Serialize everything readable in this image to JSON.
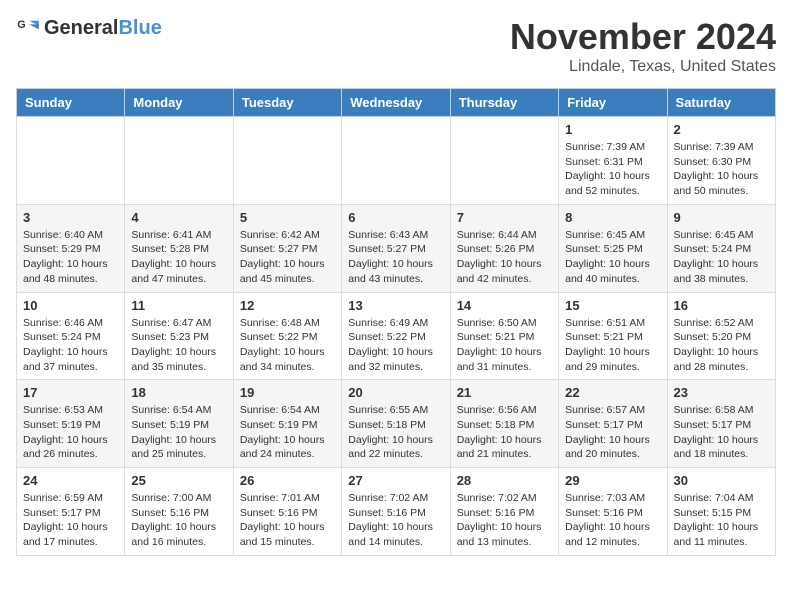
{
  "logo": {
    "general": "General",
    "blue": "Blue"
  },
  "title": "November 2024",
  "subtitle": "Lindale, Texas, United States",
  "days_of_week": [
    "Sunday",
    "Monday",
    "Tuesday",
    "Wednesday",
    "Thursday",
    "Friday",
    "Saturday"
  ],
  "weeks": [
    [
      null,
      null,
      null,
      null,
      null,
      {
        "day": "1",
        "sunrise": "Sunrise: 7:39 AM",
        "sunset": "Sunset: 6:31 PM",
        "daylight": "Daylight: 10 hours and 52 minutes."
      },
      {
        "day": "2",
        "sunrise": "Sunrise: 7:39 AM",
        "sunset": "Sunset: 6:30 PM",
        "daylight": "Daylight: 10 hours and 50 minutes."
      }
    ],
    [
      {
        "day": "3",
        "sunrise": "Sunrise: 6:40 AM",
        "sunset": "Sunset: 5:29 PM",
        "daylight": "Daylight: 10 hours and 48 minutes."
      },
      {
        "day": "4",
        "sunrise": "Sunrise: 6:41 AM",
        "sunset": "Sunset: 5:28 PM",
        "daylight": "Daylight: 10 hours and 47 minutes."
      },
      {
        "day": "5",
        "sunrise": "Sunrise: 6:42 AM",
        "sunset": "Sunset: 5:27 PM",
        "daylight": "Daylight: 10 hours and 45 minutes."
      },
      {
        "day": "6",
        "sunrise": "Sunrise: 6:43 AM",
        "sunset": "Sunset: 5:27 PM",
        "daylight": "Daylight: 10 hours and 43 minutes."
      },
      {
        "day": "7",
        "sunrise": "Sunrise: 6:44 AM",
        "sunset": "Sunset: 5:26 PM",
        "daylight": "Daylight: 10 hours and 42 minutes."
      },
      {
        "day": "8",
        "sunrise": "Sunrise: 6:45 AM",
        "sunset": "Sunset: 5:25 PM",
        "daylight": "Daylight: 10 hours and 40 minutes."
      },
      {
        "day": "9",
        "sunrise": "Sunrise: 6:45 AM",
        "sunset": "Sunset: 5:24 PM",
        "daylight": "Daylight: 10 hours and 38 minutes."
      }
    ],
    [
      {
        "day": "10",
        "sunrise": "Sunrise: 6:46 AM",
        "sunset": "Sunset: 5:24 PM",
        "daylight": "Daylight: 10 hours and 37 minutes."
      },
      {
        "day": "11",
        "sunrise": "Sunrise: 6:47 AM",
        "sunset": "Sunset: 5:23 PM",
        "daylight": "Daylight: 10 hours and 35 minutes."
      },
      {
        "day": "12",
        "sunrise": "Sunrise: 6:48 AM",
        "sunset": "Sunset: 5:22 PM",
        "daylight": "Daylight: 10 hours and 34 minutes."
      },
      {
        "day": "13",
        "sunrise": "Sunrise: 6:49 AM",
        "sunset": "Sunset: 5:22 PM",
        "daylight": "Daylight: 10 hours and 32 minutes."
      },
      {
        "day": "14",
        "sunrise": "Sunrise: 6:50 AM",
        "sunset": "Sunset: 5:21 PM",
        "daylight": "Daylight: 10 hours and 31 minutes."
      },
      {
        "day": "15",
        "sunrise": "Sunrise: 6:51 AM",
        "sunset": "Sunset: 5:21 PM",
        "daylight": "Daylight: 10 hours and 29 minutes."
      },
      {
        "day": "16",
        "sunrise": "Sunrise: 6:52 AM",
        "sunset": "Sunset: 5:20 PM",
        "daylight": "Daylight: 10 hours and 28 minutes."
      }
    ],
    [
      {
        "day": "17",
        "sunrise": "Sunrise: 6:53 AM",
        "sunset": "Sunset: 5:19 PM",
        "daylight": "Daylight: 10 hours and 26 minutes."
      },
      {
        "day": "18",
        "sunrise": "Sunrise: 6:54 AM",
        "sunset": "Sunset: 5:19 PM",
        "daylight": "Daylight: 10 hours and 25 minutes."
      },
      {
        "day": "19",
        "sunrise": "Sunrise: 6:54 AM",
        "sunset": "Sunset: 5:19 PM",
        "daylight": "Daylight: 10 hours and 24 minutes."
      },
      {
        "day": "20",
        "sunrise": "Sunrise: 6:55 AM",
        "sunset": "Sunset: 5:18 PM",
        "daylight": "Daylight: 10 hours and 22 minutes."
      },
      {
        "day": "21",
        "sunrise": "Sunrise: 6:56 AM",
        "sunset": "Sunset: 5:18 PM",
        "daylight": "Daylight: 10 hours and 21 minutes."
      },
      {
        "day": "22",
        "sunrise": "Sunrise: 6:57 AM",
        "sunset": "Sunset: 5:17 PM",
        "daylight": "Daylight: 10 hours and 20 minutes."
      },
      {
        "day": "23",
        "sunrise": "Sunrise: 6:58 AM",
        "sunset": "Sunset: 5:17 PM",
        "daylight": "Daylight: 10 hours and 18 minutes."
      }
    ],
    [
      {
        "day": "24",
        "sunrise": "Sunrise: 6:59 AM",
        "sunset": "Sunset: 5:17 PM",
        "daylight": "Daylight: 10 hours and 17 minutes."
      },
      {
        "day": "25",
        "sunrise": "Sunrise: 7:00 AM",
        "sunset": "Sunset: 5:16 PM",
        "daylight": "Daylight: 10 hours and 16 minutes."
      },
      {
        "day": "26",
        "sunrise": "Sunrise: 7:01 AM",
        "sunset": "Sunset: 5:16 PM",
        "daylight": "Daylight: 10 hours and 15 minutes."
      },
      {
        "day": "27",
        "sunrise": "Sunrise: 7:02 AM",
        "sunset": "Sunset: 5:16 PM",
        "daylight": "Daylight: 10 hours and 14 minutes."
      },
      {
        "day": "28",
        "sunrise": "Sunrise: 7:02 AM",
        "sunset": "Sunset: 5:16 PM",
        "daylight": "Daylight: 10 hours and 13 minutes."
      },
      {
        "day": "29",
        "sunrise": "Sunrise: 7:03 AM",
        "sunset": "Sunset: 5:16 PM",
        "daylight": "Daylight: 10 hours and 12 minutes."
      },
      {
        "day": "30",
        "sunrise": "Sunrise: 7:04 AM",
        "sunset": "Sunset: 5:15 PM",
        "daylight": "Daylight: 10 hours and 11 minutes."
      }
    ]
  ]
}
